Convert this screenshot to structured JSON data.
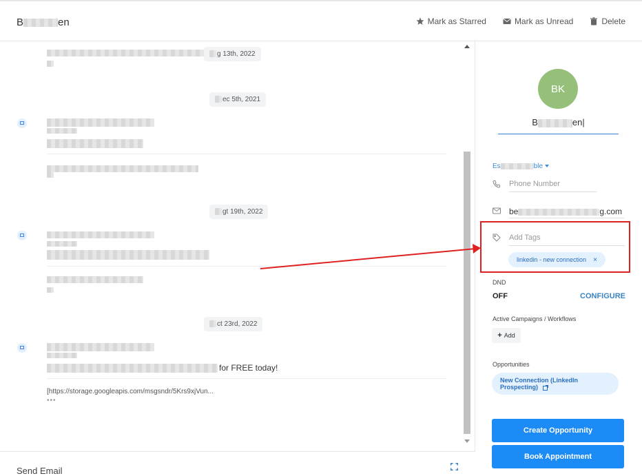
{
  "header": {
    "contact_name_prefix": "B",
    "contact_name_suffix": "en",
    "actions": {
      "star_label": "Mark as Starred",
      "unread_label": "Mark as Unread",
      "delete_label": "Delete"
    }
  },
  "conversation": {
    "dates": [
      "g 13th, 2022",
      "ec 5th, 2021",
      "gt 19th, 2022",
      "ct 23rd, 2022"
    ],
    "last_message_text": "for FREE today!",
    "link_text": "[https://storage.googleapis.com/msgsndr/5Krs9xjVun...",
    "more_dots": "•••"
  },
  "composer": {
    "send_email_label": "Send Email"
  },
  "sidebar": {
    "avatar_initials": "BK",
    "name_prefix": "B",
    "name_suffix": "en",
    "owner_prefix": "Es",
    "owner_suffix": "ble",
    "phone_placeholder": "Phone Number",
    "email_prefix": "be",
    "email_suffix": "g.com",
    "tags_placeholder": "Add Tags",
    "tags": [
      {
        "label": "linkedin - new connection",
        "remove": "×"
      }
    ],
    "dnd": {
      "label": "DND",
      "value": "OFF",
      "configure_label": "CONFIGURE"
    },
    "campaigns": {
      "label": "Active Campaigns / Workflows",
      "add_label": "Add"
    },
    "opportunities": {
      "label": "Opportunities",
      "item_label": "New Connection (LinkedIn Prospecting)"
    },
    "create_opportunity_label": "Create Opportunity",
    "book_appointment_label": "Book Appointment"
  },
  "colors": {
    "accent": "#1d8bf5",
    "avatar": "#96c07a",
    "highlight": "#e02020",
    "tag_bg": "#e3f0fd"
  }
}
